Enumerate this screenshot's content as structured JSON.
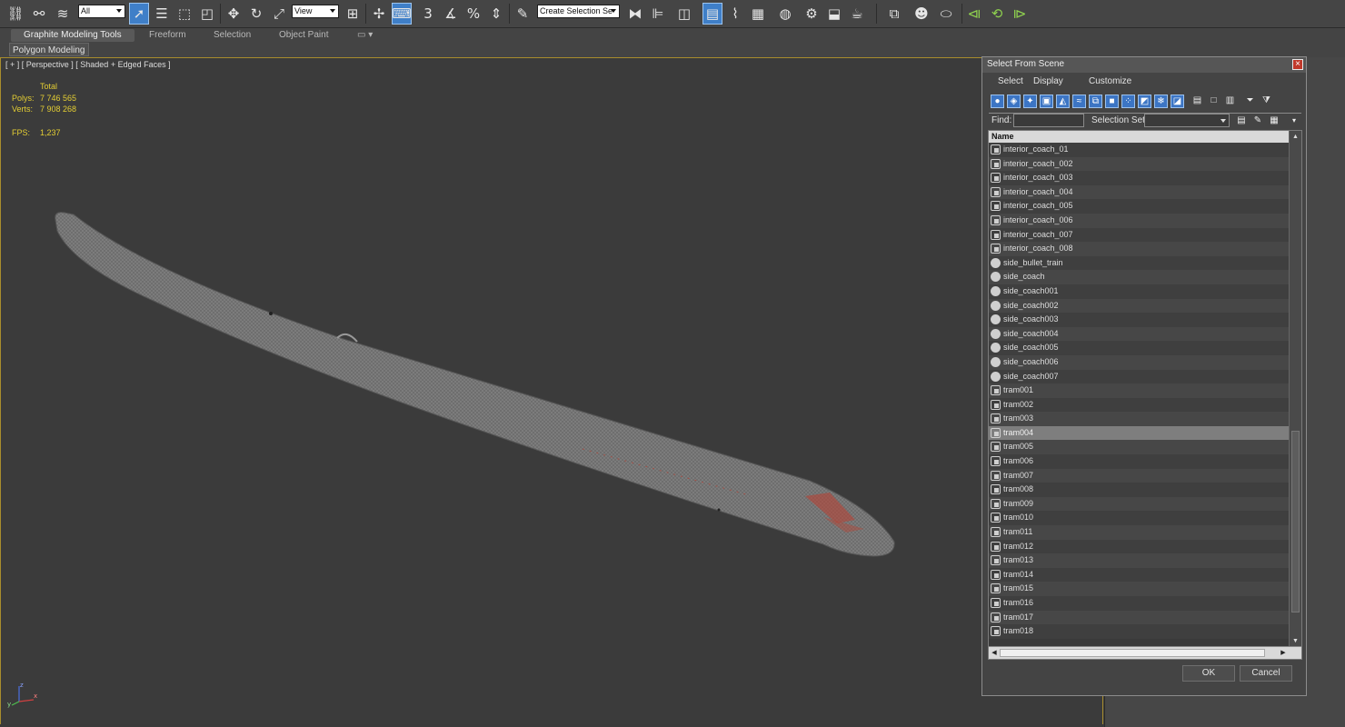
{
  "toolbar": {
    "filter_value": "All",
    "refcoord_value": "View",
    "selection_set_value": "Create Selection Se",
    "snap_labels": [
      "3",
      "%"
    ],
    "icons": [
      "link-icon",
      "unlink-icon",
      "bind-spacewarp-icon",
      "select-object-icon",
      "select-by-name-icon",
      "rect-selection-icon",
      "window-crossing-icon",
      "move-icon",
      "rotate-icon",
      "scale-icon",
      "select-manipulate-icon",
      "pivot-icon",
      "keyboard-shortcut-icon",
      "snap-toggle-icon",
      "angle-snap-icon",
      "percent-snap-icon",
      "spinner-snap-icon",
      "edit-named-selection-icon",
      "mirror-icon",
      "align-icon",
      "layer-manager-icon",
      "graphite-toggle-icon",
      "curve-editor-icon",
      "schematic-view-icon",
      "material-editor-icon",
      "render-setup-icon",
      "rendered-frame-icon",
      "render-icon",
      "render-iterative-icon",
      "container-icon",
      "populate-icon",
      "scene-states-icon",
      "key-mode-icon",
      "auto-key-icon",
      "set-key-icon"
    ]
  },
  "ribbon": {
    "tabs": [
      "Graphite Modeling Tools",
      "Freeform",
      "Selection",
      "Object Paint"
    ],
    "active_tab": "Graphite Modeling Tools",
    "panel_label": "Polygon Modeling"
  },
  "viewport": {
    "label": "[ + ] [ Perspective ] [ Shaded + Edged Faces ]",
    "stats": {
      "total_label": "Total",
      "polys_label": "Polys:",
      "polys_value": "7 746 565",
      "verts_label": "Verts:",
      "verts_value": "7 908 268",
      "fps_label": "FPS:",
      "fps_value": "1,237"
    },
    "axis_labels": [
      "z",
      "x",
      "y"
    ],
    "colors": {
      "border": "#a88d2d",
      "stats": "#e3cd33",
      "mesh": "#7a7a7a",
      "mesh_highlight": "#b0473a"
    }
  },
  "dialog": {
    "title": "Select From Scene",
    "close_label": "×",
    "menu": [
      "Select",
      "Display",
      "Customize"
    ],
    "find_label": "Find:",
    "find_value": "",
    "selection_set_label": "Selection Set:",
    "selection_set_value": "",
    "column_header": "Name",
    "selected_item": "tram004",
    "items": [
      {
        "name": "interior_coach_01",
        "icon": "group-icon"
      },
      {
        "name": "interior_coach_002",
        "icon": "group-icon"
      },
      {
        "name": "interior_coach_003",
        "icon": "group-icon"
      },
      {
        "name": "interior_coach_004",
        "icon": "group-icon"
      },
      {
        "name": "interior_coach_005",
        "icon": "group-icon"
      },
      {
        "name": "interior_coach_006",
        "icon": "group-icon"
      },
      {
        "name": "interior_coach_007",
        "icon": "group-icon"
      },
      {
        "name": "interior_coach_008",
        "icon": "group-icon"
      },
      {
        "name": "side_bullet_train",
        "icon": "geometry-icon"
      },
      {
        "name": "side_coach",
        "icon": "geometry-icon"
      },
      {
        "name": "side_coach001",
        "icon": "geometry-icon"
      },
      {
        "name": "side_coach002",
        "icon": "geometry-icon"
      },
      {
        "name": "side_coach003",
        "icon": "geometry-icon"
      },
      {
        "name": "side_coach004",
        "icon": "geometry-icon"
      },
      {
        "name": "side_coach005",
        "icon": "geometry-icon"
      },
      {
        "name": "side_coach006",
        "icon": "geometry-icon"
      },
      {
        "name": "side_coach007",
        "icon": "geometry-icon"
      },
      {
        "name": "tram001",
        "icon": "group-icon"
      },
      {
        "name": "tram002",
        "icon": "group-icon"
      },
      {
        "name": "tram003",
        "icon": "group-icon"
      },
      {
        "name": "tram004",
        "icon": "group-icon"
      },
      {
        "name": "tram005",
        "icon": "group-icon"
      },
      {
        "name": "tram006",
        "icon": "group-icon"
      },
      {
        "name": "tram007",
        "icon": "group-icon"
      },
      {
        "name": "tram008",
        "icon": "group-icon"
      },
      {
        "name": "tram009",
        "icon": "group-icon"
      },
      {
        "name": "tram010",
        "icon": "group-icon"
      },
      {
        "name": "tram011",
        "icon": "group-icon"
      },
      {
        "name": "tram012",
        "icon": "group-icon"
      },
      {
        "name": "tram013",
        "icon": "group-icon"
      },
      {
        "name": "tram014",
        "icon": "group-icon"
      },
      {
        "name": "tram015",
        "icon": "group-icon"
      },
      {
        "name": "tram016",
        "icon": "group-icon"
      },
      {
        "name": "tram017",
        "icon": "group-icon"
      },
      {
        "name": "tram018",
        "icon": "group-icon"
      }
    ],
    "ok_label": "OK",
    "cancel_label": "Cancel",
    "colors": {
      "tool_blue": "#3c75c4",
      "selected_row": "#7e7e7e",
      "close": "#c0392b"
    }
  }
}
